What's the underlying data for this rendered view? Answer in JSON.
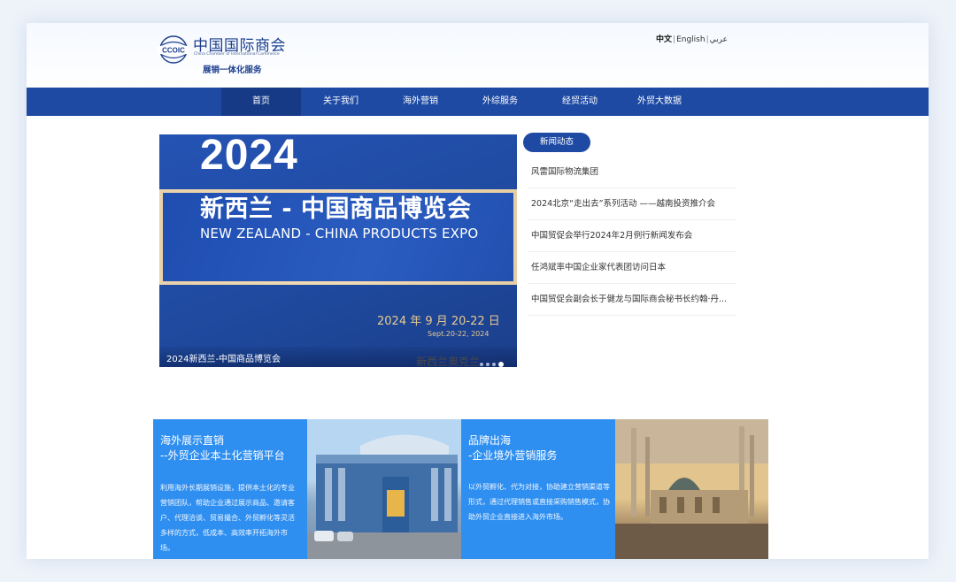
{
  "header": {
    "logo_abbr": "CCOIC",
    "logo_cn": "中国国际商会",
    "logo_en": "China Chamber of International Commerce",
    "logo_tagline": "展销一体化服务",
    "languages": [
      {
        "label": "中文",
        "active": true
      },
      {
        "label": "English",
        "active": false
      },
      {
        "label": "عربي",
        "active": false
      }
    ],
    "separator": "|"
  },
  "nav": {
    "items": [
      {
        "label": "首页",
        "active": true
      },
      {
        "label": "关于我们",
        "active": false
      },
      {
        "label": "海外营销",
        "active": false
      },
      {
        "label": "外综服务",
        "active": false
      },
      {
        "label": "经贸活动",
        "active": false
      },
      {
        "label": "外贸大数据",
        "active": false
      }
    ]
  },
  "banner": {
    "year": "2024",
    "title_cn": "新西兰 - 中国商品博览会",
    "title_en": "NEW ZEALAND - CHINA PRODUCTS EXPO",
    "date_cn": "2024 年 9 月 20-22 日",
    "date_en": "Sept.20-22, 2024",
    "watermark": "新西兰奥克兰",
    "caption": "2024新西兰-中国商品博览会",
    "slide_count": 4,
    "active_slide": 4
  },
  "news": {
    "tab_label": "新闻动态",
    "items": [
      "风雷国际物流集团",
      "2024北京“走出去”系列活动 ——越南投资推介会",
      "中国贸促会举行2024年2月例行新闻发布会",
      "任鸿斌率中国企业家代表团访问日本",
      "中国贸促会副会长于健龙与国际商会秘书长约翰·丹..."
    ]
  },
  "panels": [
    {
      "title_line1": "海外展示直销",
      "title_line2": "--外贸企业本土化营销平台",
      "desc": "利用海外长期展销设施，提供本土化的专业营销团队，帮助企业通过展示商品、邀请客户、代理洽谈、贸易撮合、外贸孵化等灵活多样的方式，低成本、高效率开拓海外市场。"
    },
    {
      "title_line1": "品牌出海",
      "title_line2": "-企业境外营销服务",
      "desc": "以外贸孵化、代为对接，协助建立营销渠道等形式，通过代理销售或直接采购销售模式，协助外贸企业直接进入海外市场。"
    }
  ],
  "colors": {
    "nav_bg": "#1e4aa4",
    "nav_active": "#163a86",
    "panel_blue": "#2f8ff0",
    "banner_gold": "#e6c98f"
  }
}
